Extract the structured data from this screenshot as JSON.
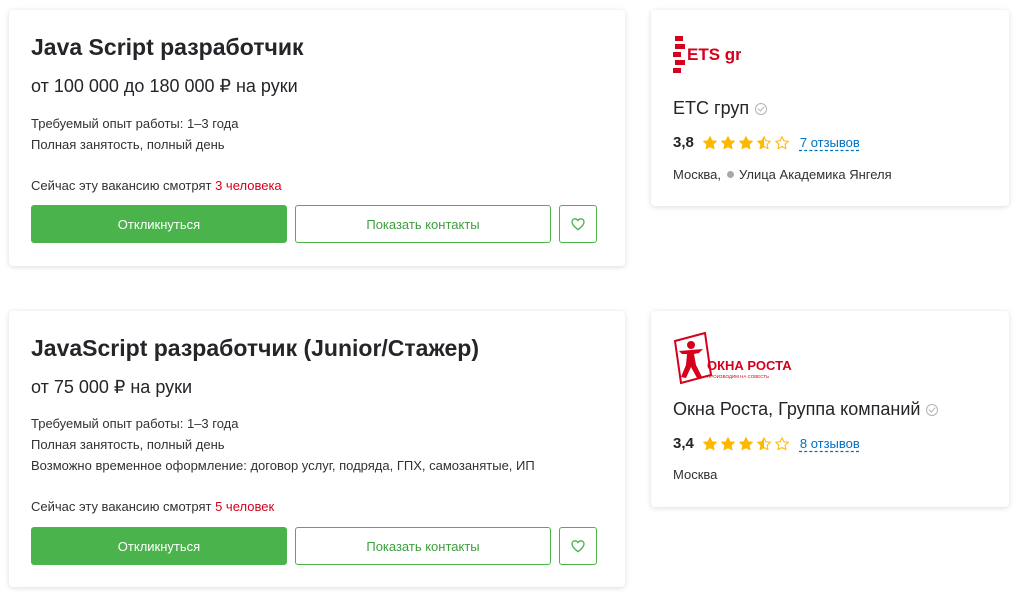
{
  "vacancies": [
    {
      "title": "Java Script разработчик",
      "salary": "от 100 000 до 180 000 ₽ на руки",
      "details": [
        "Требуемый опыт работы: 1–3 года",
        "Полная занятость, полный день"
      ],
      "watching_prefix": "Сейчас эту вакансию смотрят ",
      "watching_count": "3 человека",
      "apply_label": "Откликнуться",
      "contacts_label": "Показать контакты",
      "favorite_icon": "heart-icon",
      "employer": {
        "logo_text": "ETS group",
        "name": "ЕТС груп",
        "rating": "3,8",
        "stars": 3.5,
        "reviews": "7 отзывов",
        "city": "Москва,",
        "metro": "Улица Академика Янгеля"
      }
    },
    {
      "title": "JavaScript разработчик (Junior/Стажер)",
      "salary": "от 75 000 ₽ на руки",
      "details": [
        "Требуемый опыт работы: 1–3 года",
        "Полная занятость, полный день",
        "Возможно временное оформление: договор услуг, подряда, ГПХ, самозанятые, ИП"
      ],
      "watching_prefix": "Сейчас эту вакансию смотрят ",
      "watching_count": "5 человек",
      "apply_label": "Откликнуться",
      "contacts_label": "Показать контакты",
      "favorite_icon": "heart-icon",
      "employer": {
        "logo_text": "ОКНА РОСТА",
        "logo_subtext": "ПРОИЗВОДИМ НА СОВЕСТЬ",
        "name": "Окна Роста, Группа компаний",
        "rating": "3,4",
        "stars": 3.5,
        "reviews": "8 отзывов",
        "city": "Москва"
      }
    }
  ],
  "colors": {
    "accent": "#4bb34b",
    "star": "#ffb800",
    "link": "#0070c2",
    "highlight": "#d6001c"
  }
}
